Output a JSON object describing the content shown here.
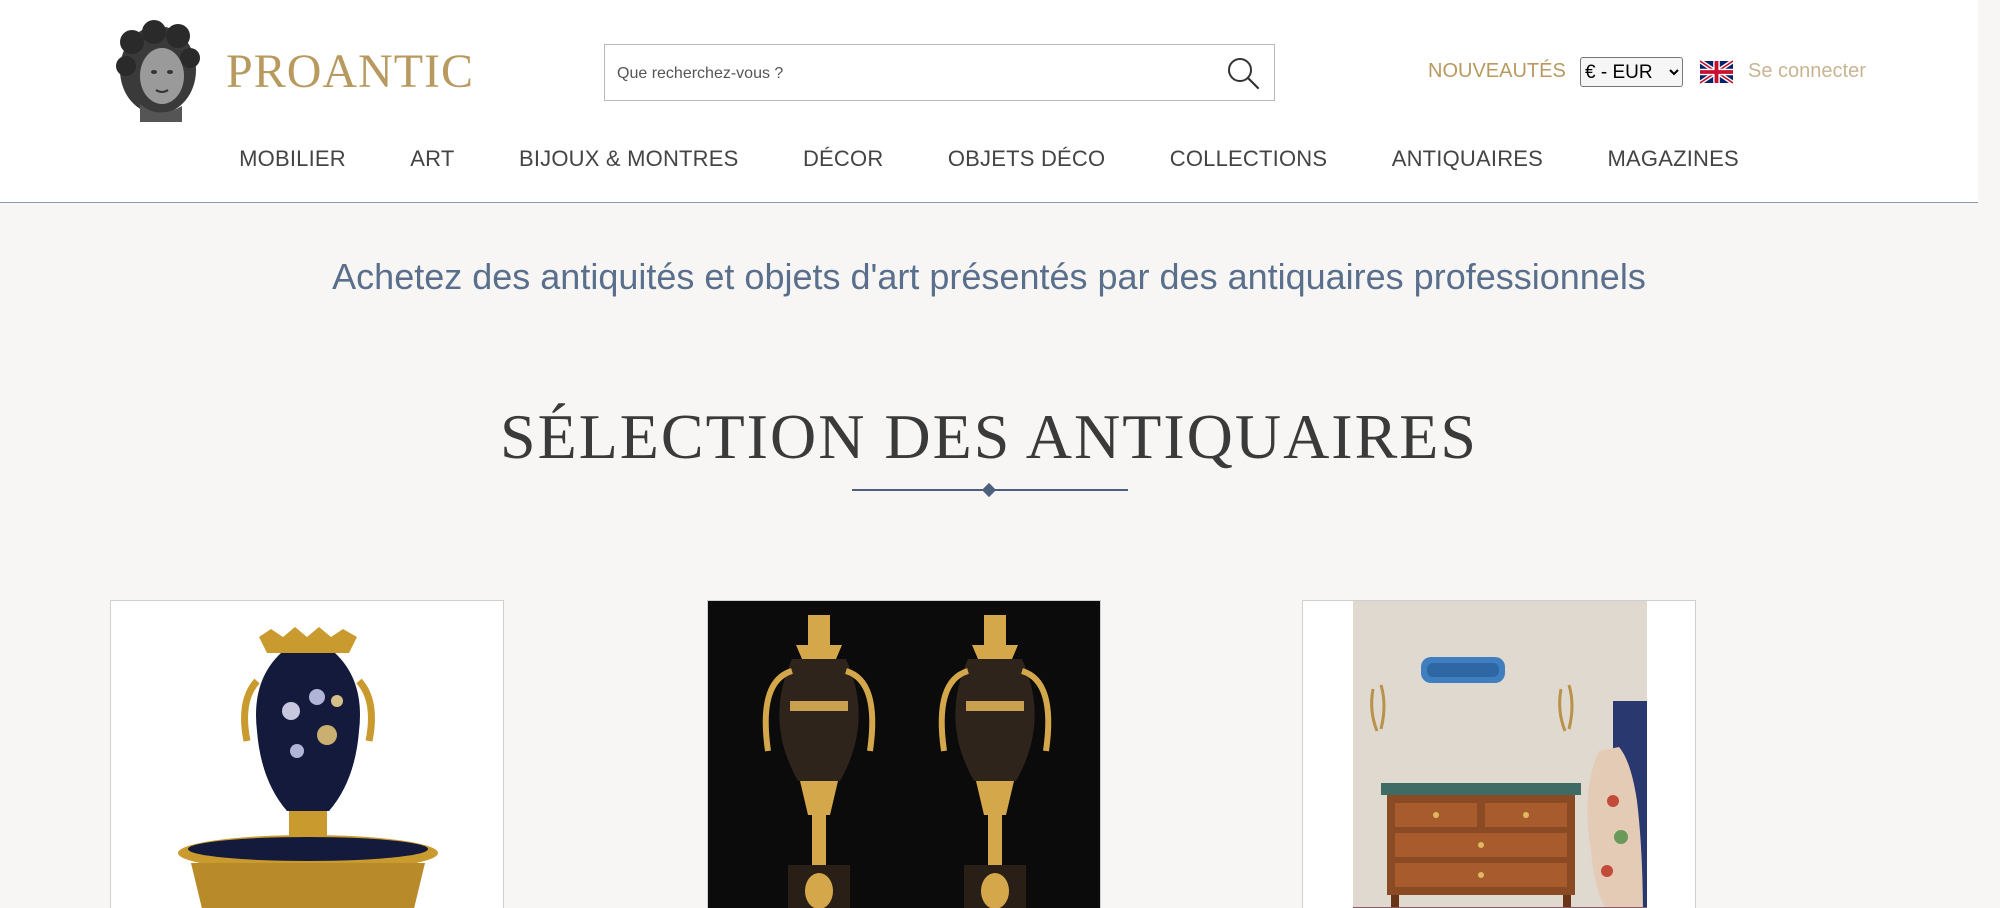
{
  "brand": {
    "name": "PROANTIC"
  },
  "search": {
    "placeholder": "Que recherchez-vous ?"
  },
  "header": {
    "nouveautes_label": "NOUVEAUTÉS",
    "currency": {
      "selected": "€ - EUR"
    },
    "connect_label": "Se connecter"
  },
  "nav": {
    "items": [
      {
        "label": "MOBILIER"
      },
      {
        "label": "ART"
      },
      {
        "label": "BIJOUX & MONTRES"
      },
      {
        "label": "DÉCOR"
      },
      {
        "label": "OBJETS DÉCO"
      },
      {
        "label": "COLLECTIONS"
      },
      {
        "label": "ANTIQUAIRES"
      },
      {
        "label": "MAGAZINES"
      }
    ]
  },
  "main": {
    "tagline": "Achetez des antiquités et objets d'art présentés par des antiquaires professionnels",
    "section_title": "SÉLECTION DES ANTIQUAIRES"
  },
  "colors": {
    "gold": "#b89a60",
    "navy": "#4c5f7c",
    "background": "#f7f6f4"
  },
  "icons": {
    "search": "search-icon",
    "flag": "uk-flag-icon",
    "logo": "bust-logo-icon"
  }
}
